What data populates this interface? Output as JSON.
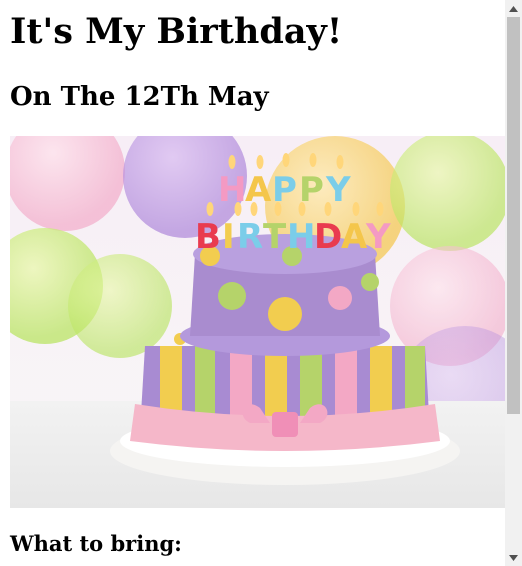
{
  "page": {
    "title": "It's My Birthday!",
    "subtitle": "On The 12Th May",
    "section_heading": "What to bring:"
  },
  "hero_image": {
    "caption_text": "HAPPY BIRTHDAY",
    "colors": {
      "cake_top": "#a98ccf",
      "cake_bottom": "#9f86cf",
      "ribbon": "#f5b7c9",
      "stripe_yellow": "#f2cd4f",
      "stripe_green": "#b5d36a",
      "stripe_pink": "#f3a8c5",
      "plate": "#f2f0ee"
    }
  },
  "scrollbar": {
    "up_icon": "triangle-up-icon",
    "down_icon": "triangle-down-icon"
  }
}
